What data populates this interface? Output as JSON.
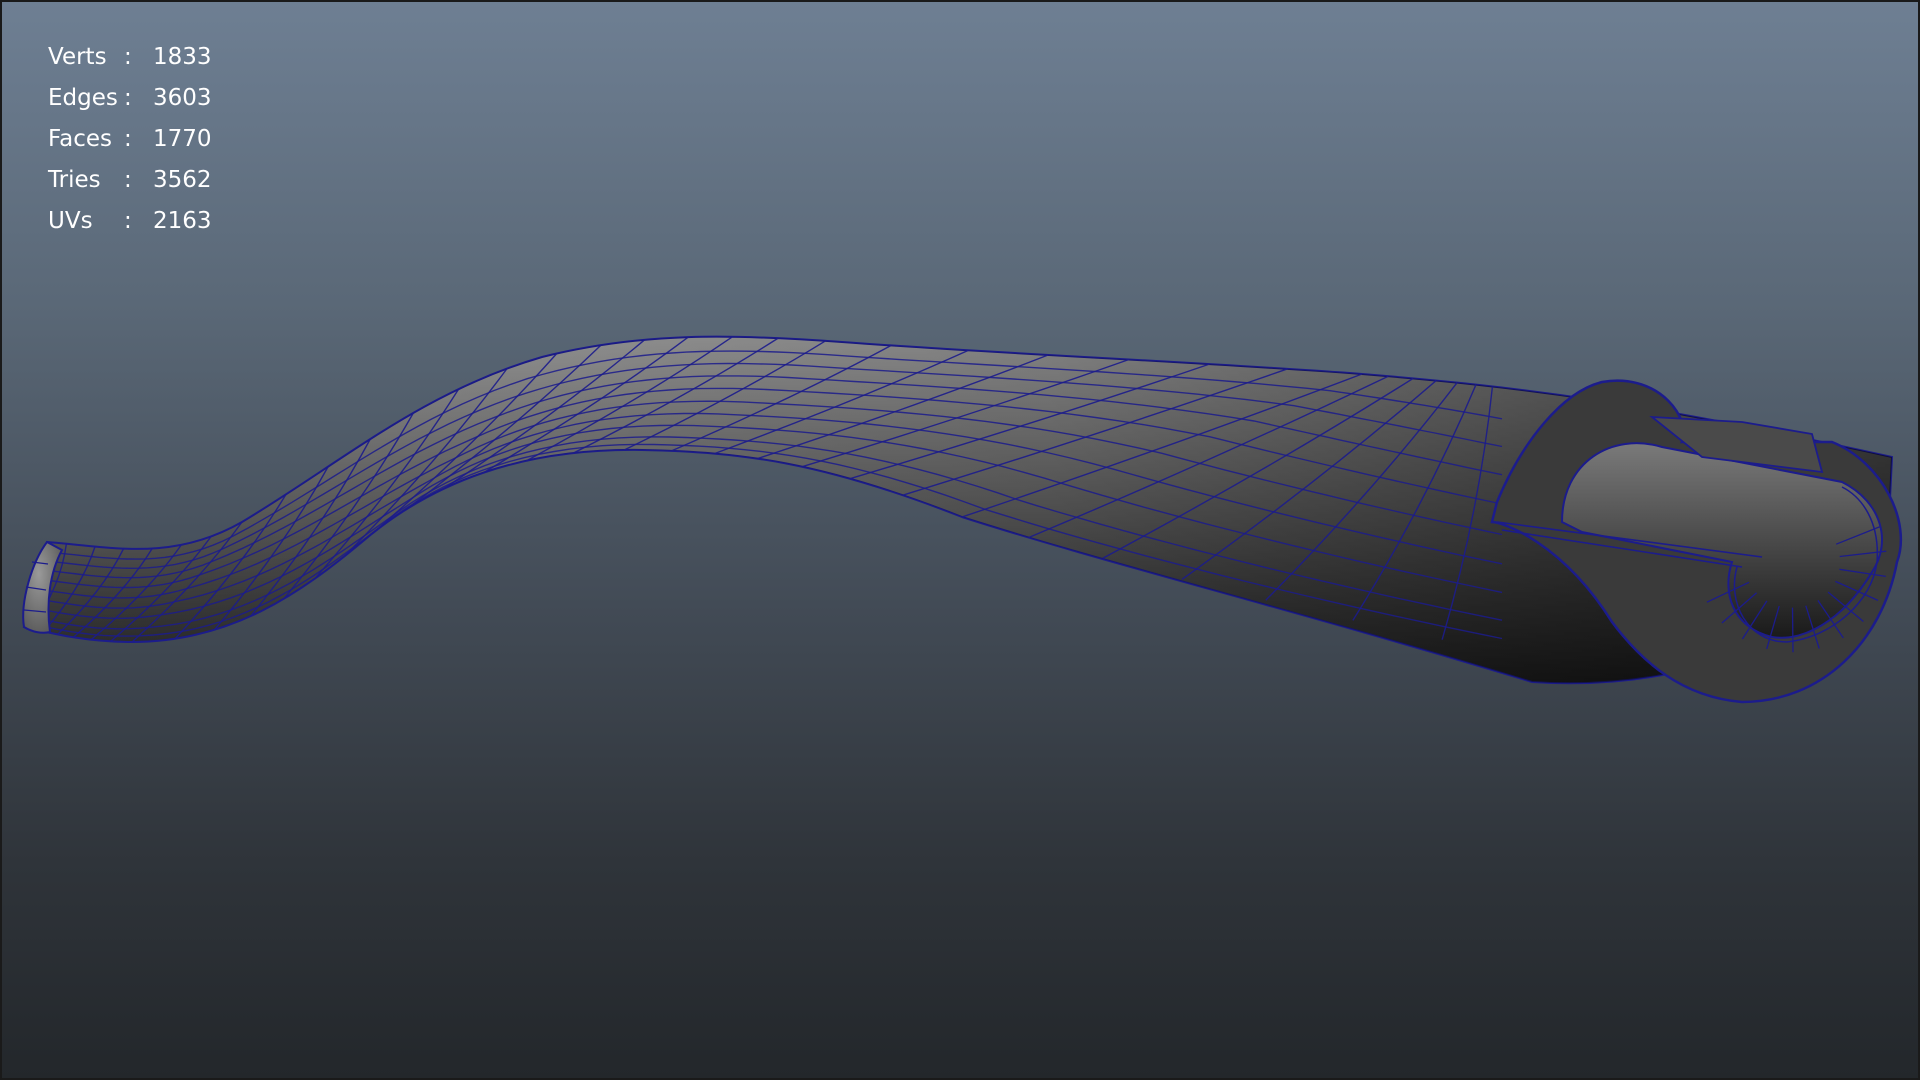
{
  "stats": [
    {
      "label": "Verts",
      "sep": ":",
      "value": "1833"
    },
    {
      "label": "Edges",
      "sep": ":",
      "value": "3603"
    },
    {
      "label": "Faces",
      "sep": ":",
      "value": "1770"
    },
    {
      "label": "Tries",
      "sep": ":",
      "value": "3562"
    },
    {
      "label": "UVs",
      "sep": ":",
      "value": "2163"
    }
  ],
  "colors": {
    "wireframe": "#1c1c8c",
    "hud_text": "#ffffff",
    "bg_top": "#6e7f93",
    "bg_bottom": "#23272b"
  }
}
